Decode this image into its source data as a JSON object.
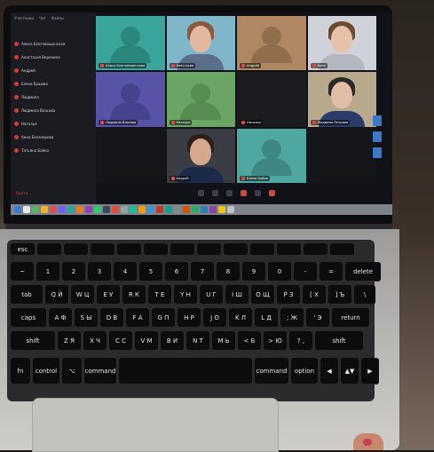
{
  "sidebar": {
    "tabs": [
      "Участники",
      "Чат",
      "Файлы"
    ],
    "participants": [
      "Алиса Благовещенская",
      "Анастасия Воронина",
      "Андрей",
      "Елена Ершова",
      "Людмила",
      "Людмила Власова",
      "Наталья",
      "Анна Белозерова",
      "Татьяна Бойко"
    ],
    "bottom_label": "Выйти"
  },
  "video_tiles": [
    {
      "name": "Алиса Благовещенская",
      "bg": "#3aa59a",
      "kind": "avatar",
      "avatar_color": "#1f6f67"
    },
    {
      "name": "Анастасия",
      "bg": "#7fb6c9",
      "kind": "person",
      "skin": "#e3b7a0",
      "hair": "#8a5a3c",
      "cloth": "#5b6f8a"
    },
    {
      "name": "Андрей",
      "bg": "#b08763",
      "kind": "avatar",
      "avatar_color": "#7a5a3d"
    },
    {
      "name": "Анна",
      "bg": "#cfd2d8",
      "kind": "person",
      "skin": "#e6c2ab",
      "hair": "#6d4b33",
      "cloth": "#b4b7bf"
    },
    {
      "name": "Людмила Власова",
      "bg": "#5753a7",
      "kind": "avatar",
      "avatar_color": "#39367a"
    },
    {
      "name": "Наталья",
      "bg": "#6aa564",
      "kind": "avatar",
      "avatar_color": "#467a41"
    },
    {
      "name": "Наталья",
      "bg": "#1c1c20",
      "kind": "blank"
    },
    {
      "name": "Людмила Петрова",
      "bg": "#b9a98c",
      "kind": "person",
      "skin": "#e2bda5",
      "hair": "#2a2a2a",
      "cloth": "#2c3c6a"
    },
    {
      "name": "",
      "bg": "#15161a",
      "kind": "blank"
    },
    {
      "name": "Андрей",
      "bg": "#3a3d43",
      "kind": "person",
      "skin": "#d6a98f",
      "hair": "#2b2118",
      "cloth": "#1c2a4a"
    },
    {
      "name": "Елена Бойко",
      "bg": "#4ea7a0",
      "kind": "avatar",
      "avatar_color": "#2f706a"
    },
    {
      "name": "",
      "bg": "#15161a",
      "kind": "blank"
    }
  ],
  "keyboard": {
    "row_fn": [
      "esc",
      "",
      "",
      "",
      "",
      "",
      "",
      "",
      "",
      "",
      "",
      "",
      ""
    ],
    "row_num": [
      "~",
      "1",
      "2",
      "3",
      "4",
      "5",
      "6",
      "7",
      "8",
      "9",
      "0",
      "-",
      "=",
      "delete"
    ],
    "row_q": [
      "tab",
      "Q Й",
      "W Ц",
      "E У",
      "R К",
      "T Е",
      "Y Н",
      "U Г",
      "I Ш",
      "O Щ",
      "P З",
      "[ Х",
      "] Ъ",
      "\\"
    ],
    "row_a": [
      "caps",
      "A Ф",
      "S Ы",
      "D В",
      "F А",
      "G П",
      "H Р",
      "J О",
      "K Л",
      "L Д",
      "; Ж",
      "' Э",
      "return"
    ],
    "row_z": [
      "shift",
      "Z Я",
      "X Ч",
      "C С",
      "V М",
      "B И",
      "N Т",
      "M Ь",
      "< Б",
      "> Ю",
      "? ,",
      "shift"
    ],
    "row_bottom": [
      "fn",
      "control",
      "⌥",
      "command",
      "",
      "command",
      "option",
      "◀",
      "▲▼",
      "▶"
    ]
  },
  "screen_colors": {
    "sidebar_bg": "#1b1c22",
    "record_red": "#d23b3b",
    "dock_gray": "#7e838c"
  }
}
